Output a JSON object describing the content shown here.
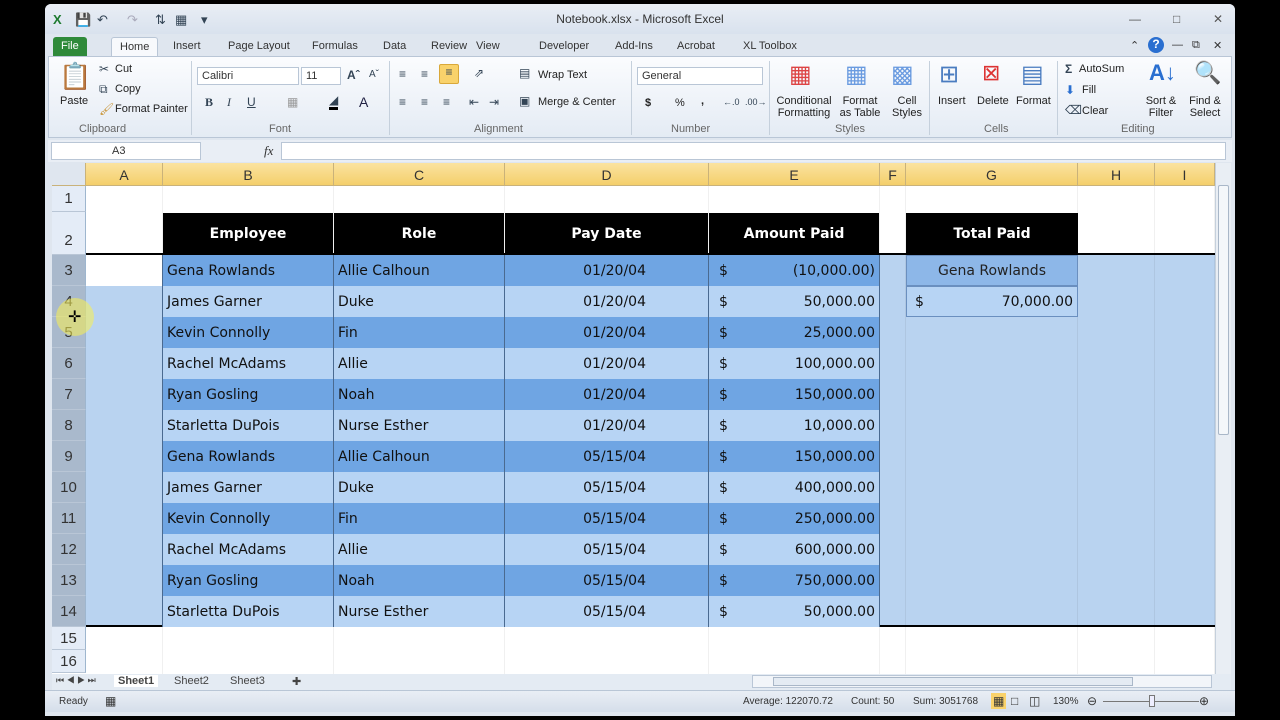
{
  "window": {
    "title": "Notebook.xlsx - Microsoft Excel"
  },
  "tabs": [
    "File",
    "Home",
    "Insert",
    "Page Layout",
    "Formulas",
    "Data",
    "Review",
    "View",
    "Developer",
    "Add-Ins",
    "Acrobat",
    "XL Toolbox"
  ],
  "ribbon": {
    "clipboard": {
      "label": "Clipboard",
      "paste": "Paste",
      "cut": "Cut",
      "copy": "Copy",
      "format_painter": "Format Painter"
    },
    "font": {
      "label": "Font",
      "name": "Calibri",
      "size": "11"
    },
    "alignment": {
      "label": "Alignment",
      "wrap": "Wrap Text",
      "merge": "Merge & Center"
    },
    "number": {
      "label": "Number",
      "format": "General",
      "currency": "$",
      "percent": "%",
      "comma": ","
    },
    "styles": {
      "label": "Styles",
      "conditional": "Conditional Formatting",
      "format_table": "Format as Table",
      "cell_styles": "Cell Styles"
    },
    "cells": {
      "label": "Cells",
      "insert": "Insert",
      "delete": "Delete",
      "format": "Format"
    },
    "editing": {
      "label": "Editing",
      "autosum": "AutoSum",
      "fill": "Fill",
      "clear": "Clear",
      "sort": "Sort & Filter",
      "find": "Find & Select"
    }
  },
  "formula_bar": {
    "name_box": "A3",
    "fx": "fx",
    "value": ""
  },
  "columns": [
    "A",
    "B",
    "C",
    "D",
    "E",
    "F",
    "G",
    "H",
    "I"
  ],
  "rows": [
    "1",
    "2",
    "3",
    "4",
    "5",
    "6",
    "7",
    "8",
    "9",
    "10",
    "11",
    "12",
    "13",
    "14",
    "15",
    "16"
  ],
  "table": {
    "headers": [
      "Employee",
      "Role",
      "Pay Date",
      "Amount Paid"
    ],
    "currency_symbol": "$",
    "records": [
      [
        "Gena Rowlands",
        "Allie Calhoun",
        "01/20/04",
        "(10,000.00)"
      ],
      [
        "James Garner",
        "Duke",
        "01/20/04",
        "50,000.00"
      ],
      [
        "Kevin Connolly",
        "Fin",
        "01/20/04",
        "25,000.00"
      ],
      [
        "Rachel McAdams",
        "Allie",
        "01/20/04",
        "100,000.00"
      ],
      [
        "Ryan Gosling",
        "Noah",
        "01/20/04",
        "150,000.00"
      ],
      [
        "Starletta DuPois",
        "Nurse Esther",
        "01/20/04",
        "10,000.00"
      ],
      [
        "Gena Rowlands",
        "Allie Calhoun",
        "05/15/04",
        "150,000.00"
      ],
      [
        "James Garner",
        "Duke",
        "05/15/04",
        "400,000.00"
      ],
      [
        "Kevin Connolly",
        "Fin",
        "05/15/04",
        "250,000.00"
      ],
      [
        "Rachel McAdams",
        "Allie",
        "05/15/04",
        "600,000.00"
      ],
      [
        "Ryan Gosling",
        "Noah",
        "05/15/04",
        "750,000.00"
      ],
      [
        "Starletta DuPois",
        "Nurse Esther",
        "05/15/04",
        "50,000.00"
      ]
    ]
  },
  "summary": {
    "header": "Total Paid",
    "name": "Gena Rowlands",
    "currency_symbol": "$",
    "total": "70,000.00"
  },
  "sheets": [
    "Sheet1",
    "Sheet2",
    "Sheet3"
  ],
  "active_sheet": "Sheet1",
  "status": {
    "ready": "Ready",
    "average": "Average: 122070.72",
    "count": "Count: 50",
    "sum": "Sum: 3051768",
    "zoom": "130%"
  },
  "colors": {
    "header_bg": "#000000",
    "band_dark": "#6fa5e3",
    "band_light": "#b7d4f4",
    "selection": "#b9d3f0",
    "col_header_selected": "#f6d67e"
  }
}
